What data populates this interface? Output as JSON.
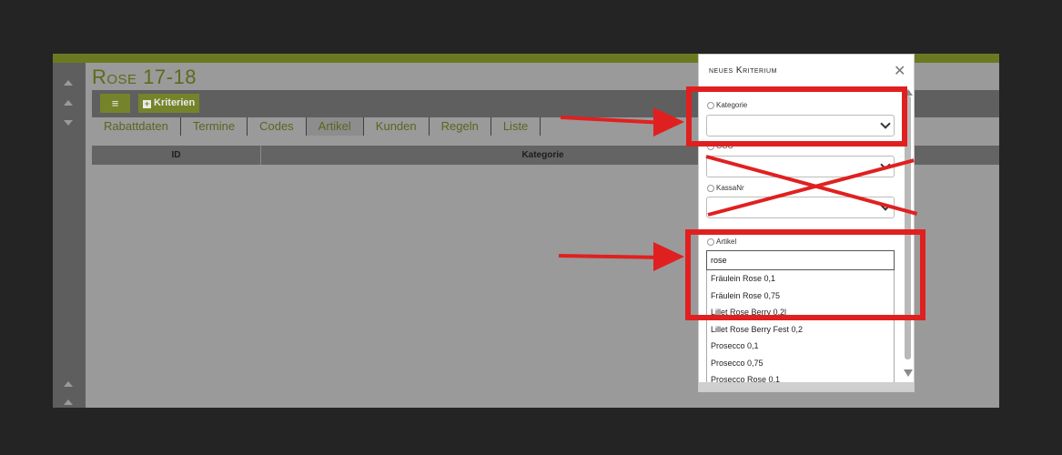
{
  "page": {
    "title": "Rose 17-18",
    "toolbar": {
      "menu_icon": "≡",
      "kriterien_label": "Kriterien"
    },
    "tabs": [
      "Rabattdaten",
      "Termine",
      "Codes",
      "Artikel",
      "Kunden",
      "Regeln",
      "Liste"
    ],
    "table": {
      "headers": [
        "ID",
        "Kategorie"
      ]
    }
  },
  "modal": {
    "title": "neues Kriterium",
    "close_label": "✕",
    "fields": {
      "kategorie_label": "Kategorie",
      "ggg_label": "GGG",
      "kassanr_label": "KassaNr",
      "artikel_label": "Artikel"
    },
    "search_value": "rose",
    "results": [
      "Fräulein Rose 0,1",
      "Fräulein Rose 0,75",
      "Lillet Rose Berry 0,2l",
      "Lillet Rose Berry Fest 0,2",
      "Prosecco 0,1",
      "Prosecco 0,75",
      "Prosecco Rose 0,1"
    ]
  },
  "colors": {
    "accent": "#75842a",
    "annotation": "#e02020"
  }
}
